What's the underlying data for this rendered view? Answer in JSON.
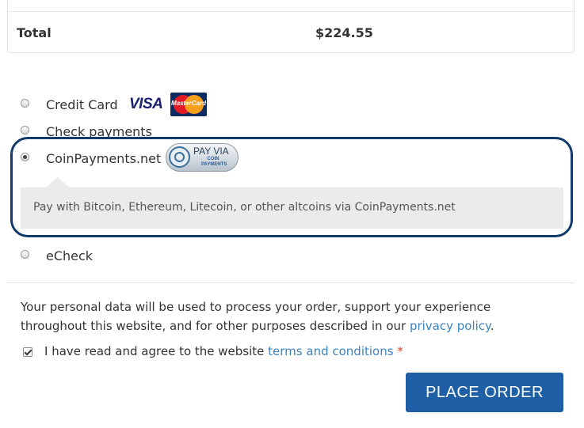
{
  "order_totals": {
    "total_label": "Total",
    "total_value": "$224.55"
  },
  "payment_methods": [
    {
      "label": "Credit Card",
      "selected": false,
      "icons": [
        "visa-logo",
        "mastercard-logo"
      ]
    },
    {
      "label": "Check payments",
      "selected": false
    },
    {
      "label": "CoinPayments.net",
      "selected": true,
      "icons": [
        "coinpayments-badge"
      ],
      "badge": {
        "line1": "PAY VIA",
        "line2": "COIN PAYMENTS"
      },
      "description": "Pay with Bitcoin, Ethereum, Litecoin, or other altcoins via CoinPayments.net"
    },
    {
      "label": "eCheck",
      "selected": false
    }
  ],
  "card_logos": {
    "visa": "VISA",
    "mastercard": "MasterCard"
  },
  "privacy": {
    "text_before": "Your personal data will be used to process your order, support your experience throughout this website, and for other purposes described in our ",
    "link_text": "privacy policy",
    "text_after": "."
  },
  "terms": {
    "checked": true,
    "text_before": "I have read and agree to the website ",
    "link_text": "terms and conditions",
    "required_marker": "*"
  },
  "place_order_label": "PLACE ORDER",
  "colors": {
    "highlight_ring": "#123b6d",
    "button": "#1f5fa6",
    "link": "#3b83c0",
    "required": "#e2401c"
  }
}
